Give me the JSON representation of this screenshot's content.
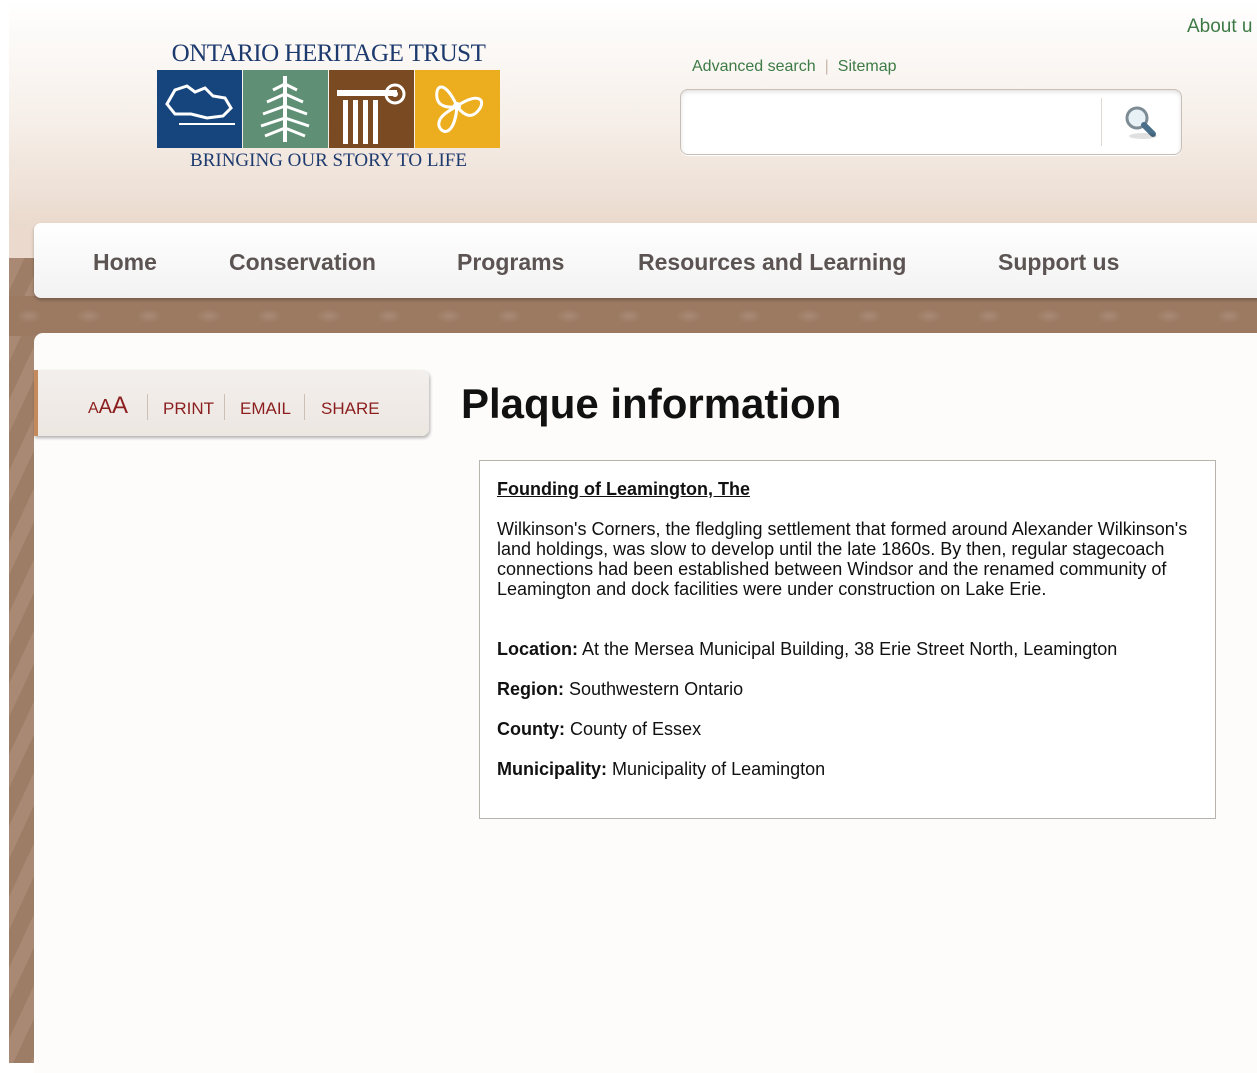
{
  "header": {
    "logo_title": "ONTARIO HERITAGE TRUST",
    "logo_tagline": "BRINGING OUR STORY TO LIFE",
    "about_link": "About u",
    "advanced_search": "Advanced search",
    "sitemap": "Sitemap",
    "search_placeholder": "",
    "colors": {
      "link_green": "#3d7a45",
      "logo_blue": "#1d3a6e"
    }
  },
  "nav": {
    "items": [
      {
        "label": "Home"
      },
      {
        "label": "Conservation"
      },
      {
        "label": "Programs"
      },
      {
        "label": "Resources and Learning"
      },
      {
        "label": "Support us"
      }
    ]
  },
  "tools": {
    "text_size_label_small": "A",
    "text_size_label_medium": "A",
    "text_size_label_large": "A",
    "print": "PRINT",
    "email": "EMAIL",
    "share": "SHARE",
    "color": "#8b1e1e"
  },
  "main": {
    "page_title": "Plaque information",
    "plaque": {
      "name": "Founding of Leamington, The",
      "text": "Wilkinson's Corners, the fledgling settlement that formed around Alexander Wilkinson's land holdings, was slow to develop until the late 1860s. By then, regular stagecoach connections had been established between Windsor and the renamed community of Leamington and dock facilities were under construction on Lake Erie.",
      "location_label": "Location:",
      "location_value": "At the Mersea Municipal Building, 38 Erie Street North, Leamington",
      "region_label": "Region:",
      "region_value": "Southwestern Ontario",
      "county_label": "County:",
      "county_value": "County of Essex",
      "municipality_label": "Municipality:",
      "municipality_value": "Municipality of Leamington"
    }
  },
  "icons": {
    "search": "magnifier-icon",
    "logo_tiles": [
      "ontario-map-icon",
      "pine-tree-icon",
      "column-icon",
      "trillium-icon"
    ]
  }
}
